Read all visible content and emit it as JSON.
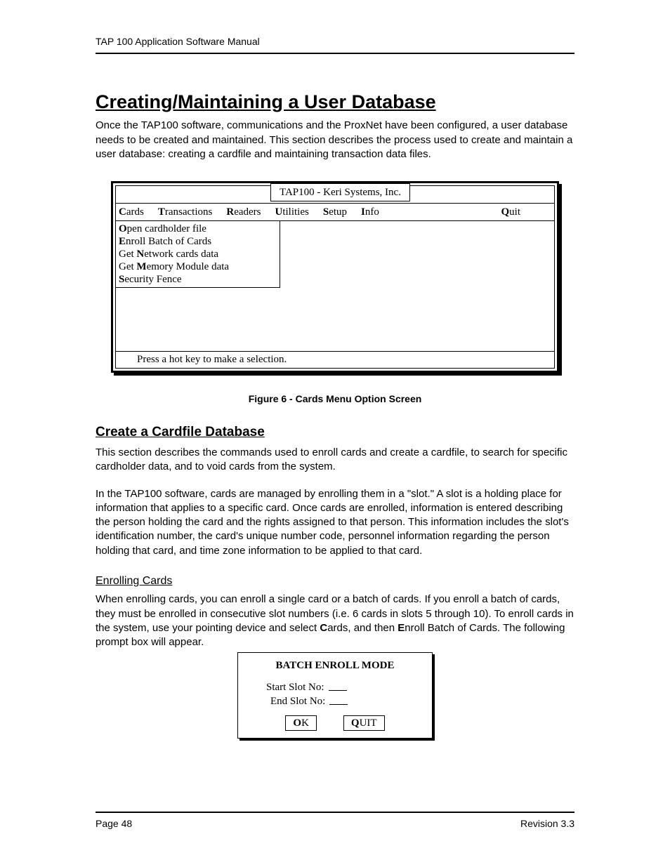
{
  "header": "TAP 100 Application Software Manual",
  "title": "Creating/Maintaining a User Database",
  "intro": "Once the TAP100 software, communications and the ProxNet have been configured, a user database needs to be created and maintained. This section describes the process used to create and maintain a user database: creating a cardfile and maintaining transaction data files.",
  "screenshot": {
    "window_title": "TAP100 - Keri Systems, Inc.",
    "menus": {
      "cards": {
        "hot": "C",
        "rest": "ards"
      },
      "transactions": {
        "hot": "T",
        "rest": "ransactions"
      },
      "readers": {
        "hot": "R",
        "rest": "eaders"
      },
      "utilities": {
        "hot": "U",
        "rest": "tilities"
      },
      "setup": {
        "hot": "S",
        "rest": "etup"
      },
      "info": {
        "hot": "I",
        "rest": "nfo"
      },
      "quit": {
        "hot": "Q",
        "rest": "uit"
      }
    },
    "cards_menu": {
      "open": {
        "hot": "O",
        "rest": "pen cardholder file"
      },
      "enroll": {
        "hot": "E",
        "rest": "nroll Batch of Cards"
      },
      "network": {
        "pre": "Get ",
        "hot": "N",
        "rest": "etwork cards data"
      },
      "memory": {
        "pre": "Get ",
        "hot": "M",
        "rest": "emory Module data"
      },
      "security": {
        "hot": "S",
        "rest": "ecurity Fence"
      }
    },
    "status": "Press a hot key to make a selection."
  },
  "figure_caption": "Figure 6 - Cards Menu Option Screen",
  "section2": {
    "title": "Create a Cardfile Database",
    "p1": "This section describes the commands used to enroll cards and create a cardfile, to search for specific cardholder data, and to void cards from the system.",
    "p2": "In the TAP100 software, cards are managed by enrolling them in a \"slot.\" A slot is a holding place for information that applies to a specific card. Once cards are enrolled, information is entered describing the person holding the card and the rights assigned to that person. This information includes the slot's identification number, the card's unique number code, personnel information regarding the person holding that card, and time zone information to be applied to that card."
  },
  "section3": {
    "title": "Enrolling Cards",
    "p1_pre": "When enrolling cards, you can enroll a single card or a batch of cards. If you enroll a batch of cards, they must be enrolled in consecutive slot numbers (i.e. 6 cards in slots 5 through 10). To enroll cards in the system, use your pointing device and select ",
    "p1_cards_hot": "C",
    "p1_mid": "ards, and then ",
    "p1_enroll_hot": "E",
    "p1_post": "nroll Batch of Cards. The following prompt box will appear."
  },
  "dialog": {
    "title": "BATCH ENROLL MODE",
    "start_label": "Start Slot No:",
    "end_label": "End Slot No:",
    "ok": {
      "hot": "O",
      "rest": "K"
    },
    "quit": {
      "hot": "Q",
      "rest": "UIT"
    }
  },
  "footer": {
    "page": "Page 48",
    "rev": "Revision 3.3"
  }
}
